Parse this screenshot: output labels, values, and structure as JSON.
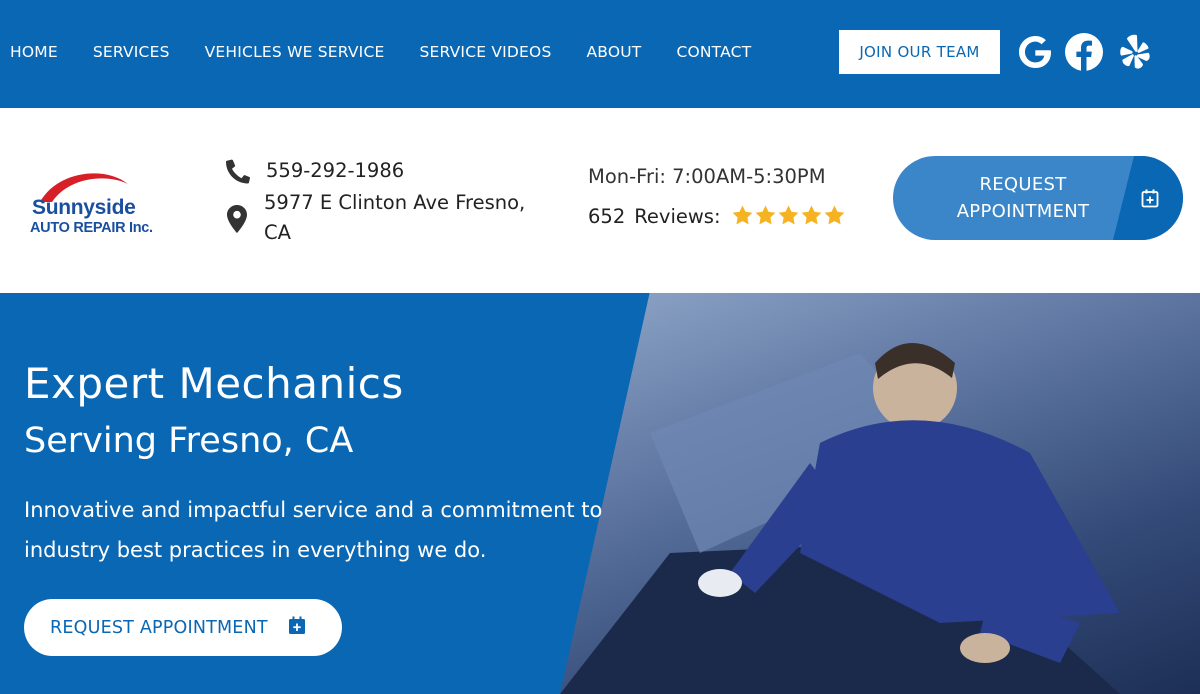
{
  "nav": {
    "items": [
      "HOME",
      "SERVICES",
      "VEHICLES WE SERVICE",
      "SERVICE VIDEOS",
      "ABOUT",
      "CONTACT"
    ],
    "join_label": "JOIN OUR TEAM",
    "social_icons": [
      "google-icon",
      "facebook-icon",
      "yelp-icon"
    ]
  },
  "logo": {
    "brand": "Sunnyside",
    "sub": "AUTO REPAIR Inc."
  },
  "contact": {
    "phone": "559-292-1986",
    "address_line1": "5977 E Clinton Ave Fresno,",
    "address_line2": "CA"
  },
  "hours": "Mon-Fri: 7:00AM-5:30PM",
  "reviews": {
    "count": "652",
    "label": "Reviews:",
    "stars": 5
  },
  "request_top": {
    "line1": "REQUEST",
    "line2": "APPOINTMENT"
  },
  "hero": {
    "title": "Expert Mechanics",
    "subtitle": "Serving Fresno, CA",
    "body": "Innovative and impactful service and a commitment to industry best practices in everything we do.",
    "button_label": "REQUEST APPOINTMENT"
  },
  "colors": {
    "primary": "#0a67b3",
    "button_light": "#3b86c8",
    "star": "#f5b323",
    "logo_red": "#d61f26"
  }
}
